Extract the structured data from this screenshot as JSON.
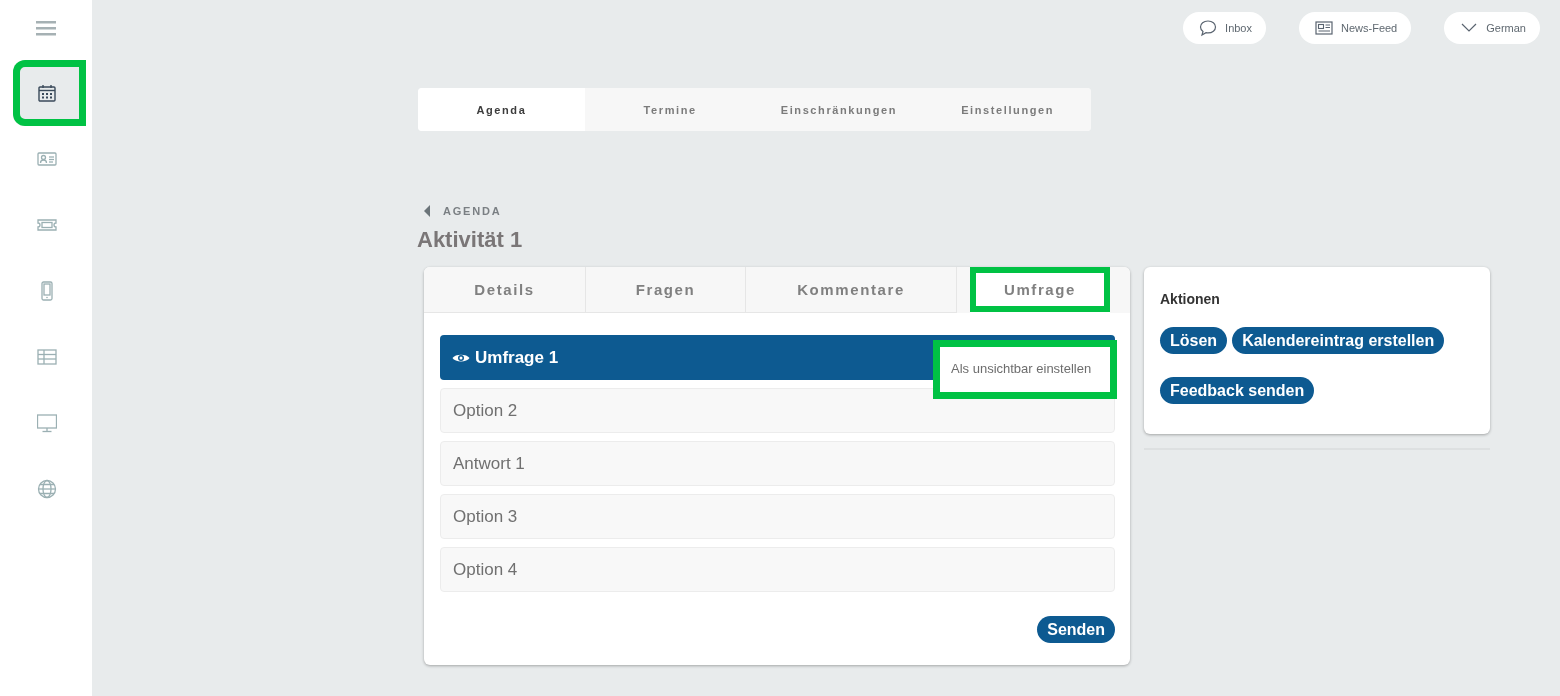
{
  "sidebar": {
    "items": [
      {
        "selected": true,
        "highlighted": true
      },
      {
        "selected": false,
        "highlighted": false
      },
      {
        "selected": false,
        "highlighted": false
      },
      {
        "selected": false,
        "highlighted": false
      },
      {
        "selected": false,
        "highlighted": false
      },
      {
        "selected": false,
        "highlighted": false
      },
      {
        "selected": false,
        "highlighted": false
      }
    ]
  },
  "topbar": {
    "buttons": [
      {
        "kind": "inbox",
        "label": "Inbox"
      },
      {
        "kind": "news",
        "label": "News-Feed"
      },
      {
        "kind": "language",
        "label": "German"
      }
    ]
  },
  "tabs": [
    {
      "label": "Agenda",
      "selected": true
    },
    {
      "label": "Termine",
      "selected": false
    },
    {
      "label": "Einschränkungen",
      "selected": false
    },
    {
      "label": "Einstellungen",
      "selected": false
    }
  ],
  "breadcrumb": "AGENDA",
  "title": "Aktivität 1",
  "card": {
    "tabs": [
      {
        "label": "Details",
        "selected": false,
        "highlighted": false
      },
      {
        "label": "Fragen",
        "selected": false,
        "highlighted": false
      },
      {
        "label": "Kommentare",
        "selected": false,
        "highlighted": false
      },
      {
        "label": "Umfrage",
        "selected": true,
        "highlighted": true
      }
    ],
    "poll": {
      "title": "Umfrage 1",
      "tooltip": {
        "text": "Als unsichtbar einstellen",
        "highlighted": true
      },
      "options": [
        "Option 2",
        "Antwort 1",
        "Option 3",
        "Option 4"
      ]
    },
    "submit": "Senden"
  },
  "actions": {
    "title": "Aktionen",
    "buttons": [
      "Lösen",
      "Kalendereintrag erstellen",
      "Feedback senden"
    ]
  }
}
